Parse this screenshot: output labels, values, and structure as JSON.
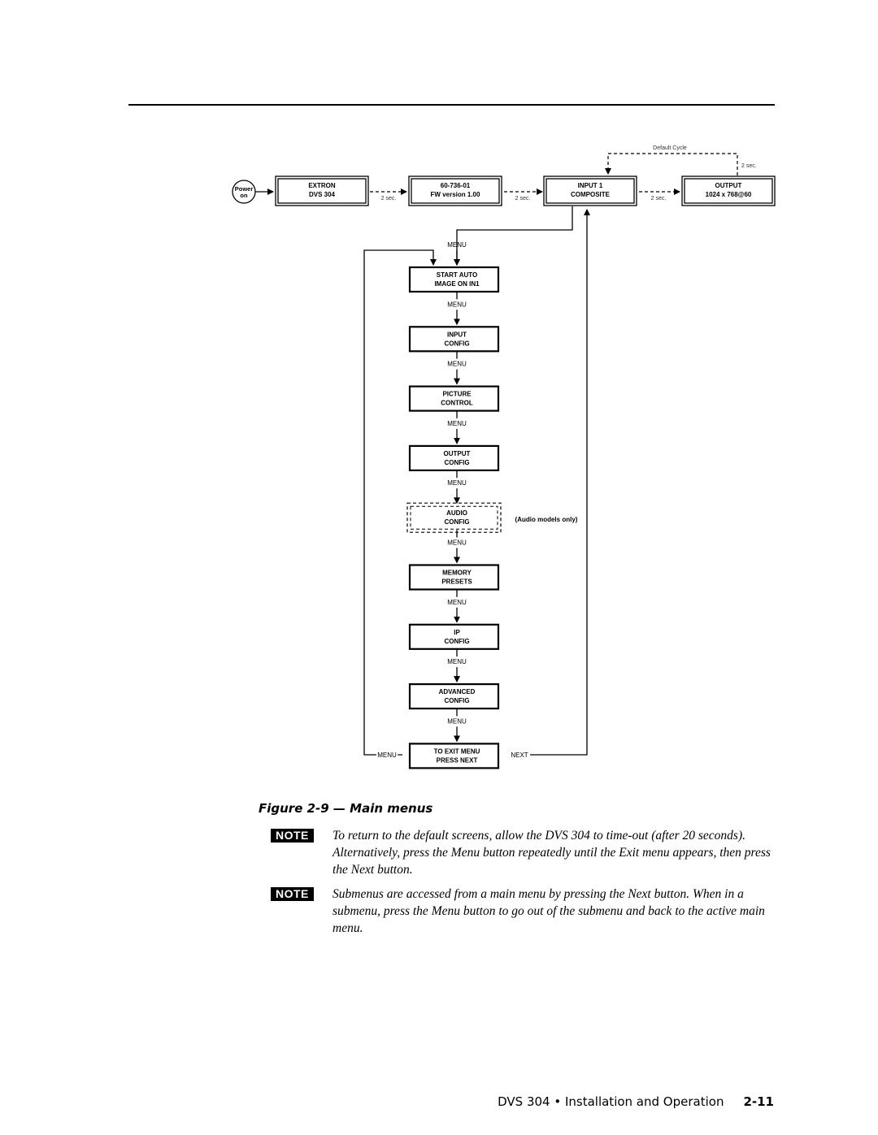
{
  "diagram": {
    "power": {
      "line1": "Power",
      "line2": "on"
    },
    "top_row": [
      {
        "line1": "EXTRON",
        "line2": "DVS 304"
      },
      {
        "line1": "60-736-01",
        "line2": "FW version 1.00"
      },
      {
        "line1": "INPUT 1",
        "line2": "COMPOSITE"
      },
      {
        "line1": "OUTPUT",
        "line2": "1024 x 768@60"
      }
    ],
    "delay_label": "2 sec.",
    "default_cycle_label": "Default Cycle",
    "menu_label": "MENU",
    "next_label": "NEXT",
    "menus": [
      {
        "line1": "START AUTO",
        "line2": "IMAGE ON IN1"
      },
      {
        "line1": "INPUT",
        "line2": "CONFIG"
      },
      {
        "line1": "PICTURE",
        "line2": "CONTROL"
      },
      {
        "line1": "OUTPUT",
        "line2": "CONFIG"
      },
      {
        "line1": "AUDIO",
        "line2": "CONFIG",
        "optional": true
      },
      {
        "line1": "MEMORY",
        "line2": "PRESETS"
      },
      {
        "line1": "IP",
        "line2": "CONFIG"
      },
      {
        "line1": "ADVANCED",
        "line2": "CONFIG"
      },
      {
        "line1": "TO EXIT MENU",
        "line2": "PRESS NEXT"
      }
    ],
    "audio_note": "(Audio models only)"
  },
  "caption": "Figure 2-9 — Main menus",
  "notes": [
    {
      "badge": "NOTE",
      "text": "To return to the default screens, allow the DVS 304 to time-out (after 20 seconds). Alternatively, press the Menu button repeatedly until the Exit menu appears, then press the Next button."
    },
    {
      "badge": "NOTE",
      "text": "Submenus are accessed from a main menu by pressing the Next button. When in a submenu, press the Menu button to go out of the submenu and back to the active main menu."
    }
  ],
  "footer": {
    "title": "DVS 304 • Installation and Operation",
    "page": "2-11"
  }
}
